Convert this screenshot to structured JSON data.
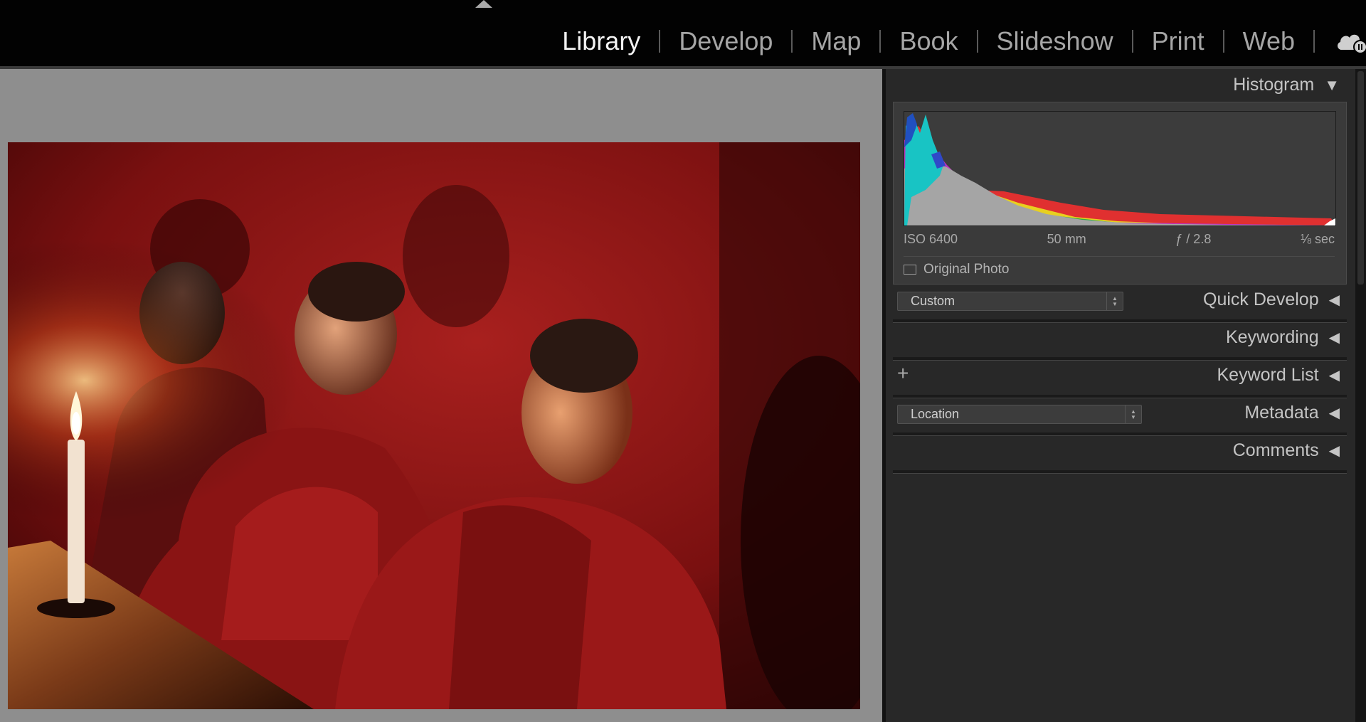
{
  "modules": [
    {
      "label": "Library",
      "active": true
    },
    {
      "label": "Develop",
      "active": false
    },
    {
      "label": "Map",
      "active": false
    },
    {
      "label": "Book",
      "active": false
    },
    {
      "label": "Slideshow",
      "active": false
    },
    {
      "label": "Print",
      "active": false
    },
    {
      "label": "Web",
      "active": false
    }
  ],
  "icons": {
    "top_toggle": "triangle-up-icon",
    "cloud": "cloud-sync-icon",
    "collapse_down": "triangle-down-icon",
    "collapse_left": "triangle-left-icon",
    "add": "plus-icon"
  },
  "histogram": {
    "title": "Histogram",
    "exif": {
      "iso": "ISO 6400",
      "focal_length": "50 mm",
      "aperture": "ƒ / 2.8",
      "shutter": "⅛ sec"
    },
    "original_photo_label": "Original Photo",
    "original_photo_checked": false
  },
  "quick_develop": {
    "title": "Quick Develop",
    "preset_value": "Custom"
  },
  "keywording": {
    "title": "Keywording"
  },
  "keyword_list": {
    "title": "Keyword List",
    "add_symbol": "+"
  },
  "metadata": {
    "title": "Metadata",
    "preset_value": "Location"
  },
  "comments": {
    "title": "Comments"
  },
  "colors": {
    "accent_active": "#f2f2f2",
    "inactive_text": "#a5a5a5",
    "panel_bg": "#282828",
    "photo_bg": "#8e8e8e"
  }
}
